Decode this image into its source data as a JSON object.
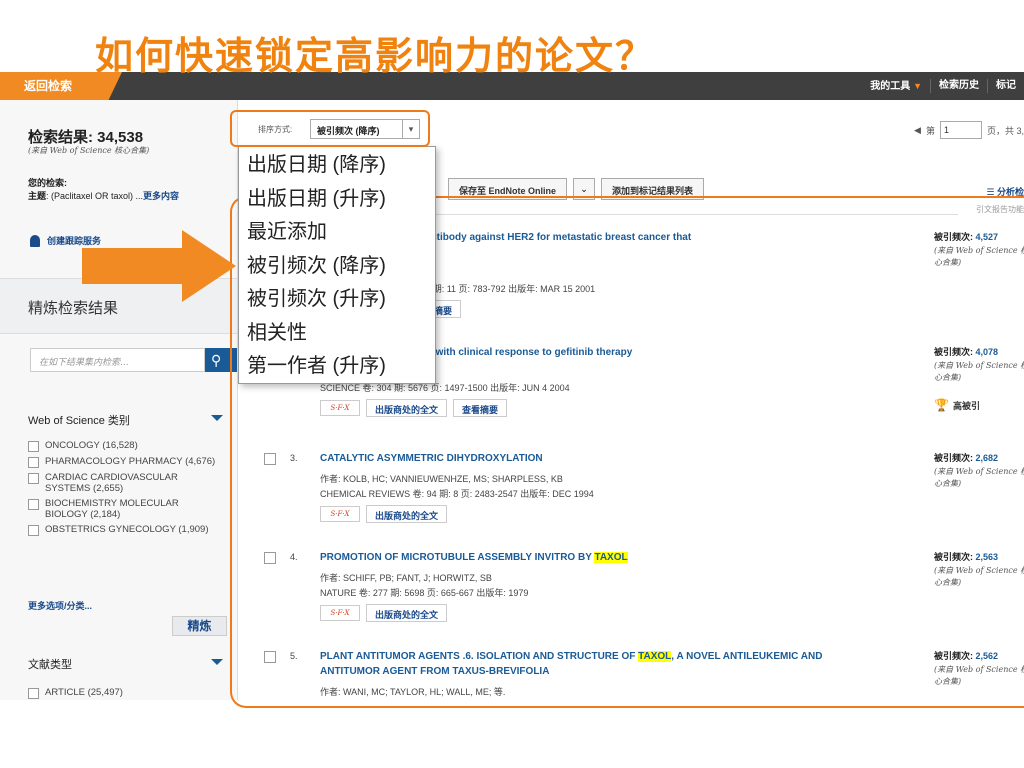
{
  "slide": {
    "title": "如何快速锁定高影响力的论文？"
  },
  "colors": {
    "accent": "#f18a22",
    "topbar": "#3f3f3f",
    "link": "#1a5a96",
    "highlight": "#ffff00",
    "annotation": "#f07a1a"
  },
  "topbar": {
    "back_label": "返回检索",
    "nav": {
      "my_tools": "我的工具",
      "search_history": "检索历史",
      "marked": "标记"
    }
  },
  "sidebar": {
    "result_count": "检索结果: 34,538",
    "source": "(来自 Web of Science 核心合集)",
    "your_query_label": "您的检索:",
    "query_prefix": "主题",
    "query_text": ": (Paclitaxel OR taxol) ...",
    "query_more": "更多内容",
    "create_alert": "创建跟踪服务",
    "refine_title": "精炼检索结果",
    "refine_placeholder": "在如下结果集内检索...",
    "category_heading": "Web of Science 类别",
    "categories": [
      {
        "label": "ONCOLOGY (16,528)"
      },
      {
        "label": "PHARMACOLOGY PHARMACY (4,676)"
      },
      {
        "label": "CARDIAC CARDIOVASCULAR SYSTEMS (2,655)"
      },
      {
        "label": "BIOCHEMISTRY MOLECULAR BIOLOGY (2,184)"
      },
      {
        "label": "OBSTETRICS GYNECOLOGY (1,909)"
      }
    ],
    "more_options": "更多选项/分类...",
    "refine_button": "精炼",
    "doctype_heading": "文献类型",
    "doctype_first": "ARTICLE (25,497)"
  },
  "main": {
    "sort_label": "排序方式:",
    "sort_value": "被引频次 (降序)",
    "pager": {
      "prefix": "第",
      "page": "1",
      "suffix": "页，共 3,"
    },
    "save_endnote": "保存至 EndNote Online",
    "add_marked": "添加到标记结果列表",
    "analyze": "分析检",
    "citation_report": "引文报告功能",
    "cite_label": "被引频次:",
    "cite_source": "(来自 Web of Science 核心合集)",
    "sfx": "S·F·X",
    "full_text": "出版商处的全文",
    "abstract": "查看摘要",
    "highly_cited": "高被引",
    "records": [
      {
        "num": "",
        "title_pre": "py plus a monoclonal antibody against HER2 for metastatic breast cancer that",
        "title_hl": "",
        "title_post": "",
        "title_line2": "2.",
        "authors": "and-Jones, B; Shak, S; 等.",
        "journal": "NAL OF MEDICINE  卷: 344  期: 11  页: 783-792  出版年: MAR 15 2001",
        "cites": "4,527"
      },
      {
        "num": "",
        "title_pre": "ung cancer: Correlation with clinical response to gefitinib therapy",
        "title_hl": "",
        "title_post": "",
        "title_line2": "",
        "authors": "PA; Lee, JC; 等.",
        "journal": "SCIENCE  卷: 304  期: 5676  页: 1497-1500  出版年: JUN 4 2004",
        "cites": "4,078"
      },
      {
        "num": "3.",
        "title_pre": "CATALYTIC ASYMMETRIC DIHYDROXYLATION",
        "title_hl": "",
        "title_post": "",
        "title_line2": "",
        "authors": "作者: KOLB, HC; VANNIEUWENHZE, MS; SHARPLESS, KB",
        "journal": "CHEMICAL REVIEWS  卷: 94  期: 8  页: 2483-2547  出版年: DEC 1994",
        "cites": "2,682"
      },
      {
        "num": "4.",
        "title_pre": "PROMOTION OF MICROTUBULE ASSEMBLY INVITRO BY ",
        "title_hl": "TAXOL",
        "title_post": "",
        "title_line2": "",
        "authors": "作者: SCHIFF, PB; FANT, J; HORWITZ, SB",
        "journal": "NATURE  卷: 277  期: 5698  页: 665-667  出版年: 1979",
        "cites": "2,563"
      },
      {
        "num": "5.",
        "title_pre": "PLANT ANTITUMOR AGENTS .6. ISOLATION AND STRUCTURE OF ",
        "title_hl": "TAXOL",
        "title_post": ", A NOVEL ANTILEUKEMIC AND",
        "title_line2": "ANTITUMOR AGENT FROM TAXUS-BREVIFOLIA",
        "authors": "作者: WANI, MC; TAYLOR, HL; WALL, ME; 等.",
        "journal": "",
        "cites": "2,562"
      }
    ]
  },
  "dropdown": {
    "options": [
      {
        "label": "出版日期 (降序)"
      },
      {
        "label": "出版日期 (升序)"
      },
      {
        "label": "最近添加"
      },
      {
        "label": "被引频次 (降序)"
      },
      {
        "label": "被引频次 (升序)"
      },
      {
        "label": "相关性"
      },
      {
        "label": "第一作者 (升序)"
      }
    ]
  }
}
